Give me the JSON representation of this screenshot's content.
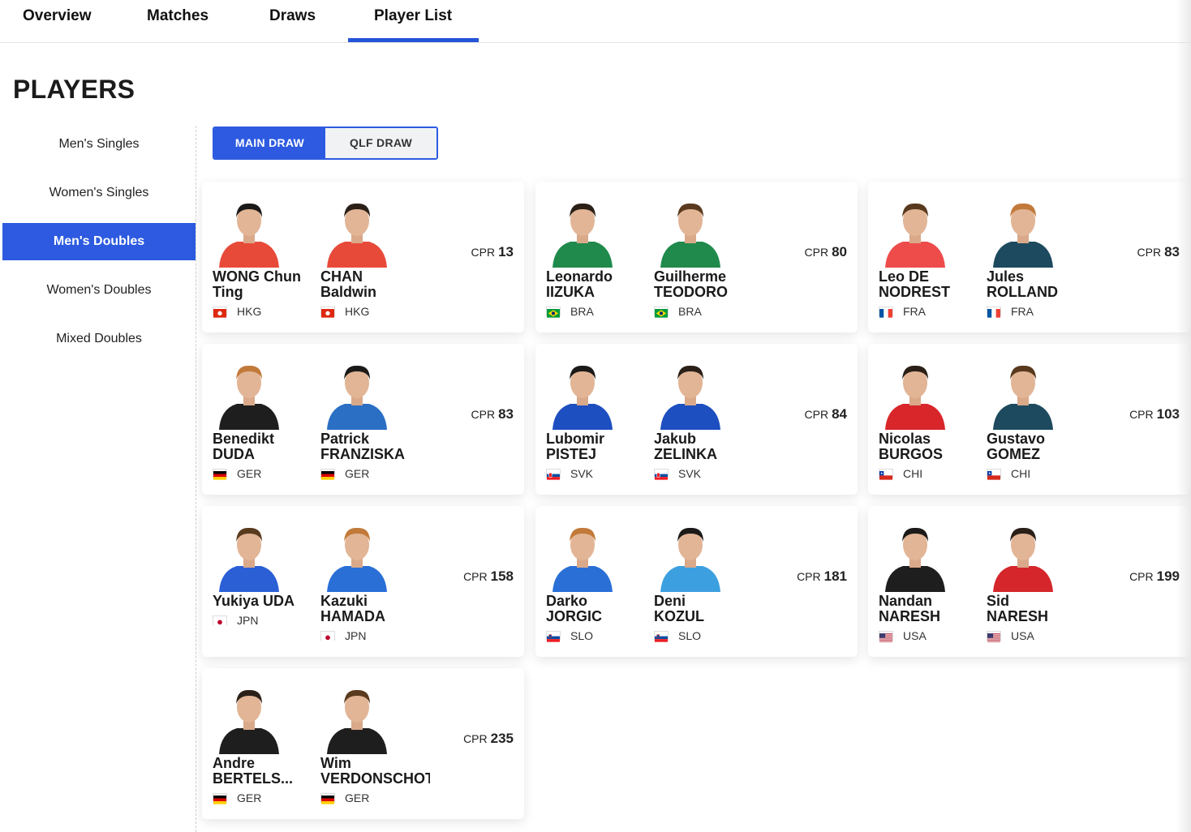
{
  "tabs": [
    {
      "label": "Overview"
    },
    {
      "label": "Matches"
    },
    {
      "label": "Draws"
    },
    {
      "label": "Player List",
      "active": true
    }
  ],
  "page_title": "PLAYERS",
  "sidebar": {
    "items": [
      {
        "label": "Men's Singles"
      },
      {
        "label": "Women's Singles"
      },
      {
        "label": "Men's Doubles",
        "active": true
      },
      {
        "label": "Women's Doubles"
      },
      {
        "label": "Mixed Doubles"
      }
    ]
  },
  "draw_toggle": {
    "main": "MAIN DRAW",
    "qlf": "QLF DRAW",
    "selected": "main"
  },
  "cpr_label": "CPR",
  "pairs": [
    {
      "cpr": "13",
      "players": [
        {
          "first": "WONG Chun",
          "last": "Ting",
          "country": "HKG",
          "flag": "hkg",
          "shirt": "#e84a3a"
        },
        {
          "first": "CHAN",
          "last": "Baldwin",
          "country": "HKG",
          "flag": "hkg",
          "shirt": "#e84a3a"
        }
      ]
    },
    {
      "cpr": "80",
      "players": [
        {
          "first": "Leonardo",
          "last": "IIZUKA",
          "country": "BRA",
          "flag": "bra",
          "shirt": "#1f8a4c"
        },
        {
          "first": "Guilherme",
          "last": "TEODORO",
          "country": "BRA",
          "flag": "bra",
          "shirt": "#1f8a4c"
        }
      ]
    },
    {
      "cpr": "83",
      "players": [
        {
          "first": "Leo DE",
          "last": "NODREST",
          "country": "FRA",
          "flag": "fra",
          "shirt": "#ee4b4b"
        },
        {
          "first": "Jules",
          "last": "ROLLAND",
          "country": "FRA",
          "flag": "fra",
          "shirt": "#1d4a5e"
        }
      ]
    },
    {
      "cpr": "83",
      "players": [
        {
          "first": "Benedikt",
          "last": "DUDA",
          "country": "GER",
          "flag": "ger",
          "shirt": "#1e1e1e"
        },
        {
          "first": "Patrick",
          "last": "FRANZISKA",
          "country": "GER",
          "flag": "ger",
          "shirt": "#2a6fc4"
        }
      ]
    },
    {
      "cpr": "84",
      "players": [
        {
          "first": "Lubomir",
          "last": "PISTEJ",
          "country": "SVK",
          "flag": "svk",
          "shirt": "#1d4fc0"
        },
        {
          "first": "Jakub",
          "last": "ZELINKA",
          "country": "SVK",
          "flag": "svk",
          "shirt": "#1d4fc0"
        }
      ]
    },
    {
      "cpr": "103",
      "players": [
        {
          "first": "Nicolas",
          "last": "BURGOS",
          "country": "CHI",
          "flag": "chi",
          "shirt": "#d8262b"
        },
        {
          "first": "Gustavo",
          "last": "GOMEZ",
          "country": "CHI",
          "flag": "chi",
          "shirt": "#1d4a5e"
        }
      ]
    },
    {
      "cpr": "158",
      "players": [
        {
          "first": "Yukiya UDA",
          "last": "",
          "country": "JPN",
          "flag": "jpn",
          "shirt": "#2a5fd6"
        },
        {
          "first": "Kazuki",
          "last": "HAMADA",
          "country": "JPN",
          "flag": "jpn",
          "shirt": "#2a6fd6"
        }
      ]
    },
    {
      "cpr": "181",
      "players": [
        {
          "first": "Darko",
          "last": "JORGIC",
          "country": "SLO",
          "flag": "slo",
          "shirt": "#2a6fd6"
        },
        {
          "first": "Deni",
          "last": "KOZUL",
          "country": "SLO",
          "flag": "slo",
          "shirt": "#3ca0e0"
        }
      ]
    },
    {
      "cpr": "199",
      "players": [
        {
          "first": "Nandan",
          "last": "NARESH",
          "country": "USA",
          "flag": "usa",
          "shirt": "#1e1e1e"
        },
        {
          "first": "Sid",
          "last": "NARESH",
          "country": "USA",
          "flag": "usa",
          "shirt": "#d4262b"
        }
      ]
    },
    {
      "cpr": "235",
      "players": [
        {
          "first": "Andre",
          "last": "BERTELS...",
          "country": "GER",
          "flag": "ger",
          "shirt": "#1e1e1e"
        },
        {
          "first": "Wim",
          "last": "VERDONSCHOT",
          "country": "GER",
          "flag": "ger",
          "shirt": "#1e1e1e"
        }
      ]
    }
  ]
}
